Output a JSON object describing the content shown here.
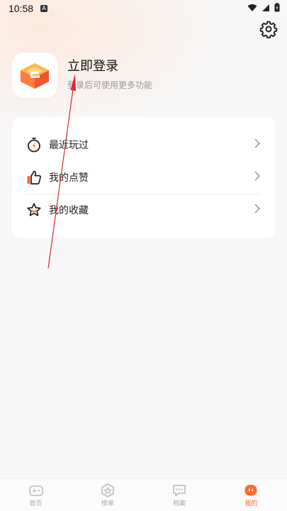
{
  "status_bar": {
    "time": "10:58",
    "notification_icon": "a-notification-icon",
    "icons": [
      "wifi-icon",
      "signal-icon",
      "battery-icon"
    ]
  },
  "header": {
    "settings_icon": "gear-icon"
  },
  "profile": {
    "title": "立即登录",
    "subtitle": "登录后可使用更多功能",
    "logo_icon": "app-logo-icon"
  },
  "menu": {
    "items": [
      {
        "label": "最近玩过",
        "icon": "stopwatch-icon"
      },
      {
        "label": "我的点赞",
        "icon": "thumbs-up-icon"
      },
      {
        "label": "我的收藏",
        "icon": "star-icon"
      }
    ]
  },
  "tabbar": {
    "tabs": [
      {
        "label": "首页",
        "icon": "gamepad-icon",
        "active": false
      },
      {
        "label": "榜单",
        "icon": "badge-star-icon",
        "active": false
      },
      {
        "label": "档案",
        "icon": "chat-icon",
        "active": false
      },
      {
        "label": "我的",
        "icon": "mascot-icon",
        "active": true
      }
    ]
  },
  "colors": {
    "accent": "#ff6a2a",
    "annotation_arrow": "#d9283a"
  }
}
